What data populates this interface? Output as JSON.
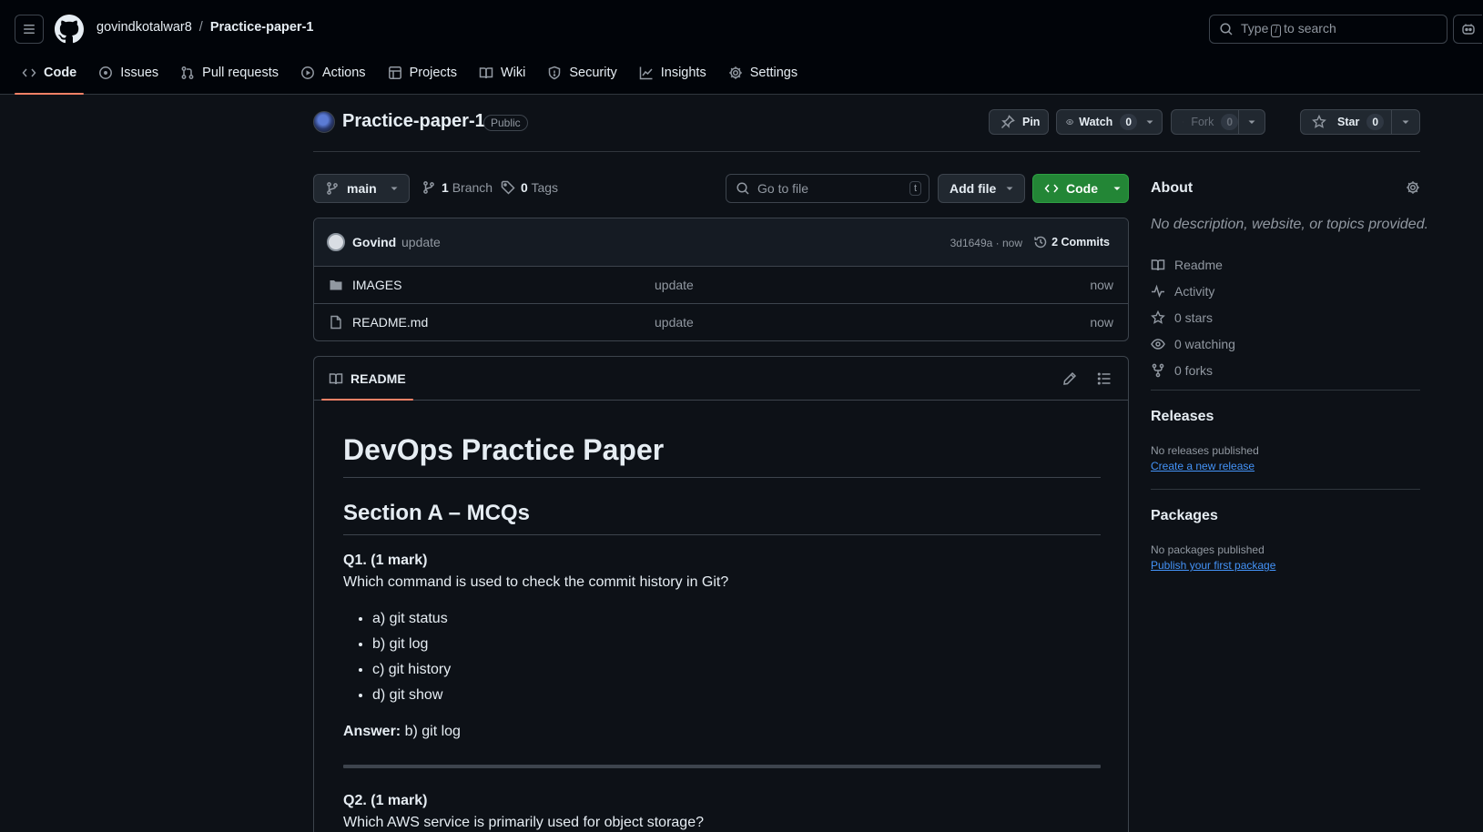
{
  "header": {
    "owner": "govindkotalwar8",
    "separator": "/",
    "repo": "Practice-paper-1",
    "search_prefix": "Type",
    "search_key": "/",
    "search_suffix": "to search"
  },
  "nav": {
    "items": [
      {
        "label": "Code",
        "icon": "code-icon",
        "active": true
      },
      {
        "label": "Issues",
        "icon": "issue-icon"
      },
      {
        "label": "Pull requests",
        "icon": "pull-request-icon"
      },
      {
        "label": "Actions",
        "icon": "play-icon"
      },
      {
        "label": "Projects",
        "icon": "table-icon"
      },
      {
        "label": "Wiki",
        "icon": "book-icon"
      },
      {
        "label": "Security",
        "icon": "shield-icon"
      },
      {
        "label": "Insights",
        "icon": "graph-icon"
      },
      {
        "label": "Settings",
        "icon": "gear-icon"
      }
    ]
  },
  "repo_header": {
    "title": "Practice-paper-1",
    "visibility": "Public",
    "pin_label": "Pin",
    "watch_label": "Watch",
    "watch_count": "0",
    "fork_label": "Fork",
    "fork_count": "0",
    "star_label": "Star",
    "star_count": "0"
  },
  "toolbar": {
    "branch": "main",
    "branch_count": "1",
    "branch_label": "Branch",
    "tag_count": "0",
    "tag_label": "Tags",
    "goto_placeholder": "Go to file",
    "goto_key": "t",
    "add_file": "Add file",
    "code": "Code"
  },
  "commit": {
    "author": "Govind",
    "message": "update",
    "sha_time": "3d1649a · now",
    "count_label": "2 Commits"
  },
  "files": [
    {
      "name": "IMAGES",
      "type": "folder",
      "message": "update",
      "date": "now"
    },
    {
      "name": "README.md",
      "type": "file",
      "message": "update",
      "date": "now"
    }
  ],
  "readme": {
    "tab": "README",
    "h1": "DevOps Practice Paper",
    "h2": "Section A – MCQs",
    "q1": {
      "title": "Q1. (1 mark)",
      "question": "Which command is used to check the commit history in Git?",
      "options": [
        "a) git status",
        "b) git log",
        "c) git history",
        "d) git show"
      ],
      "answer_label": "Answer:",
      "answer": " b) git log"
    },
    "q2": {
      "title": "Q2. (1 mark)",
      "question": "Which AWS service is primarily used for object storage?"
    }
  },
  "about": {
    "title": "About",
    "description": "No description, website, or topics provided.",
    "items": [
      {
        "label": "Readme",
        "icon": "book-icon"
      },
      {
        "label": "Activity",
        "icon": "pulse-icon"
      },
      {
        "label": "0 stars",
        "icon": "star-icon"
      },
      {
        "label": "0 watching",
        "icon": "eye-icon"
      },
      {
        "label": "0 forks",
        "icon": "fork-icon"
      }
    ]
  },
  "releases": {
    "title": "Releases",
    "empty": "No releases published",
    "link": "Create a new release"
  },
  "packages": {
    "title": "Packages",
    "empty": "No packages published",
    "link": "Publish your first package"
  },
  "colors": {
    "background": "#0d1117",
    "header_bg": "#010409",
    "accent_underline": "#f78166",
    "code_button": "#238636",
    "link": "#4493f8"
  }
}
